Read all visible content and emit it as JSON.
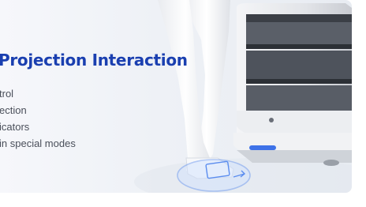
{
  "section": {
    "title": "Projection Interaction",
    "features": [
      "trol",
      "ection",
      "icators",
      "in special modes"
    ]
  },
  "colors": {
    "title": "#1a3fb0",
    "text": "#4a4f5a",
    "background": "#eef1f6",
    "projection_ring": "#5b8def"
  },
  "icons": [
    "delivery-robot-illustration",
    "person-silhouette",
    "floor-projection-ring-icon"
  ]
}
